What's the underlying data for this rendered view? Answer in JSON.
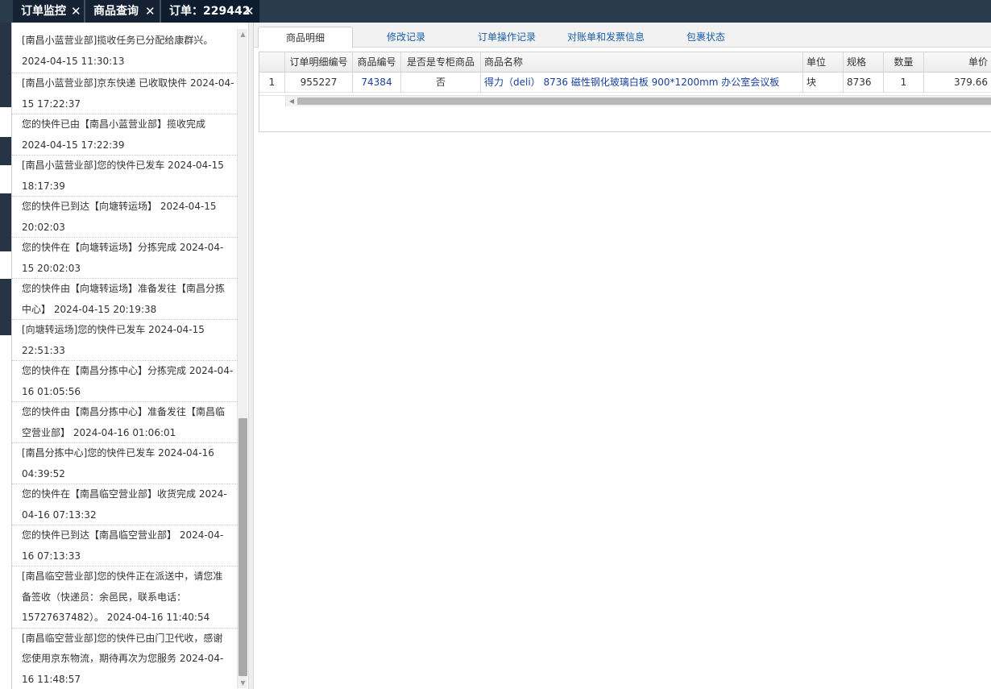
{
  "top_tabs": [
    {
      "label": "订单监控",
      "close": "✕"
    },
    {
      "label": "商品查询",
      "close": "✕"
    },
    {
      "label": "订单：229442",
      "close": "✕"
    }
  ],
  "tracking": [
    "[南昌小蓝营业部]揽收任务已分配给康群兴。\n2024-04-15 11:30:13",
    "[南昌小蓝营业部]京东快递 已收取快件 2024-04-\n15 17:22:37",
    "您的快件已由【南昌小蓝营业部】揽收完成\n2024-04-15 17:22:39",
    "[南昌小蓝营业部]您的快件已发车 2024-04-15\n18:17:39",
    "您的快件已到达【向塘转运场】 2024-04-15\n20:02:03",
    "您的快件在【向塘转运场】分拣完成 2024-04-\n15 20:02:03",
    "您的快件由【向塘转运场】准备发往【南昌分拣\n中心】 2024-04-15 20:19:38",
    "[向塘转运场]您的快件已发车 2024-04-15\n22:51:33",
    "您的快件在【南昌分拣中心】分拣完成 2024-04-\n16 01:05:56",
    "您的快件由【南昌分拣中心】准备发往【南昌临\n空营业部】 2024-04-16 01:06:01",
    "[南昌分拣中心]您的快件已发车 2024-04-16\n04:39:52",
    "您的快件在【南昌临空营业部】收货完成 2024-\n04-16 07:13:32",
    "您的快件已到达【南昌临空营业部】 2024-04-\n16 07:13:33",
    "[南昌临空营业部]您的快件正在派送中，请您准\n备签收（快递员：余邑民，联系电话：\n15727637482）。 2024-04-16 11:40:54",
    "[南昌临空营业部]您的快件已由门卫代收，感谢\n您使用京东物流，期待再次为您服务 2024-04-\n16 11:48:57"
  ],
  "sub_tabs": [
    "商品明细",
    "修改记录",
    "订单操作记录",
    "对账单和发票信息",
    "包裹状态"
  ],
  "grid": {
    "columns": [
      "",
      "订单明细编号",
      "商品编号",
      "是否是专柜商品",
      "商品名称",
      "单位",
      "规格",
      "数量",
      "单价"
    ],
    "rows": [
      [
        "1",
        "955227",
        "74384",
        "否",
        "得力（deli） 8736 磁性钢化玻璃白板 900*1200mm 办公室会议板",
        "块",
        "8736",
        "1",
        "379.66"
      ]
    ]
  },
  "scroll_glyphs": {
    "up": "▲",
    "down": "▼",
    "left": "◀"
  }
}
